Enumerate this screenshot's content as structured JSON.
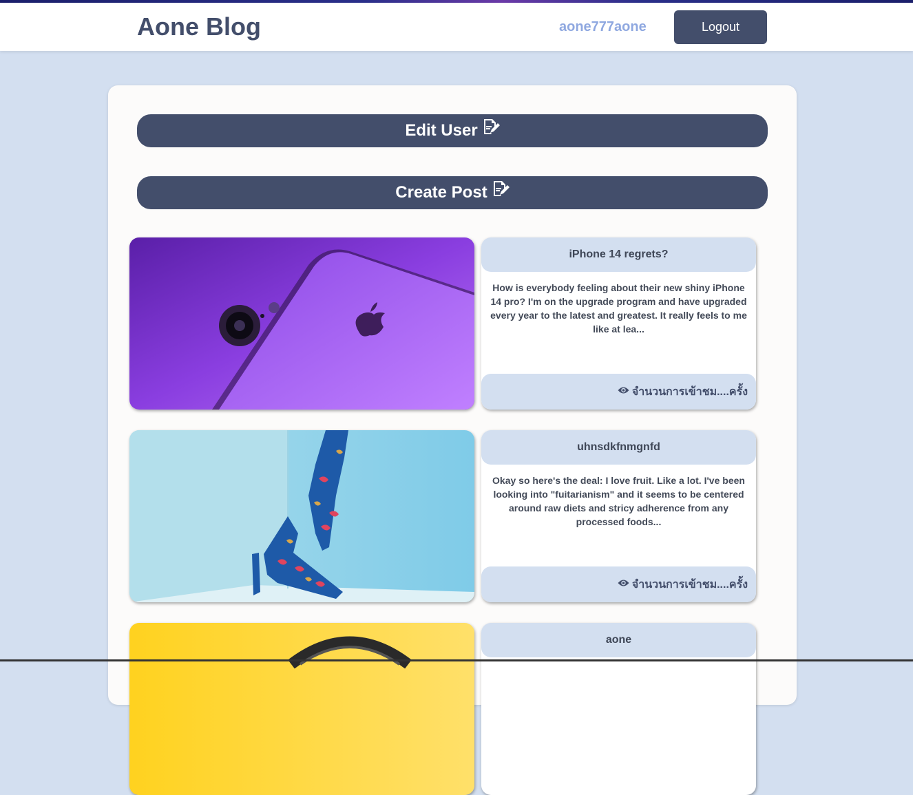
{
  "header": {
    "brand": "Aone Blog",
    "username": "aone777aone",
    "logout_label": "Logout"
  },
  "actions": {
    "edit_user_label": "Edit User",
    "create_post_label": "Create Post"
  },
  "posts": [
    {
      "title": "iPhone 14 regrets?",
      "excerpt": "How is everybody feeling about their new shiny iPhone 14 pro? I'm on the upgrade program and have upgraded every year to the latest and greatest. It really feels to me like at lea...",
      "views_label": "จำนวนการเข้าชม....ครั้ง",
      "image": "purple-iphone-photo"
    },
    {
      "title": "uhnsdkfnmgnfd",
      "excerpt": "Okay so here's the deal: I love fruit. Like a lot. I've been looking into \"fuitarianism\" and it seems to be centered around raw diets and stricy adherence from any processed foods...",
      "views_label": "จำนวนการเข้าชม....ครั้ง",
      "image": "floral-high-heels-photo"
    },
    {
      "title": "aone",
      "excerpt": "",
      "views_label": "",
      "image": "yellow-headphones-photo"
    }
  ],
  "colors": {
    "accent": "#434e6b",
    "background": "#d3dff0",
    "username": "#8fa8e0"
  },
  "icons": {
    "edit": "edit-document-icon",
    "views": "eye-icon"
  }
}
